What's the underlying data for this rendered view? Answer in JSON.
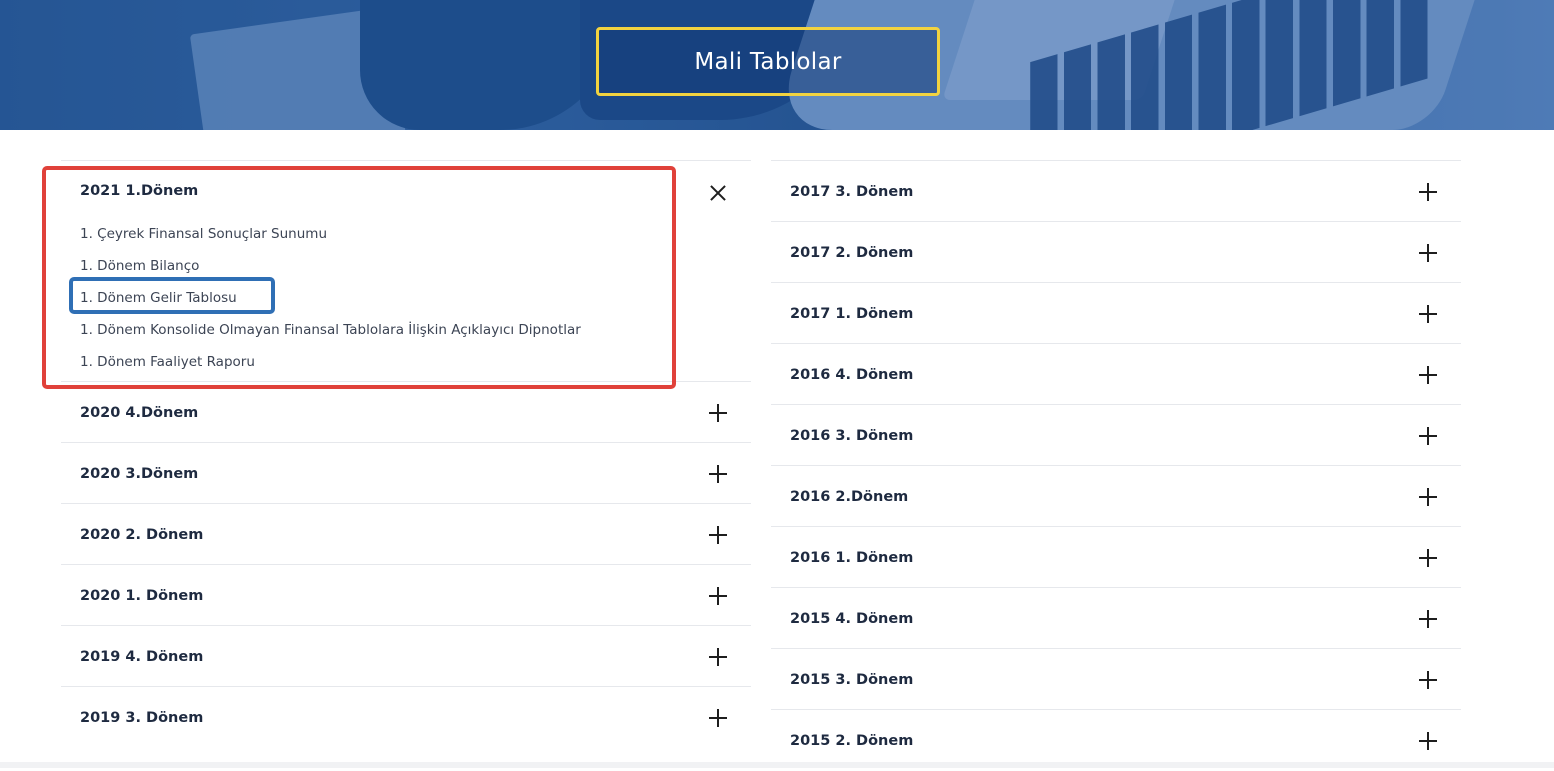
{
  "page": {
    "title": "Mali Tablolar"
  },
  "colors": {
    "title_border": "#f2d340",
    "highlight_red": "#e0413a",
    "highlight_blue": "#2f6fb5",
    "hero_blue": "#2f5f98"
  },
  "left_column": {
    "open_item": {
      "title": "2021 1.Dönem",
      "icon": "close-icon",
      "links": [
        "1. Çeyrek Finansal Sonuçlar Sunumu",
        "1. Dönem Bilanço",
        "1. Dönem Gelir Tablosu",
        "1. Dönem Konsolide Olmayan Finansal Tablolara İlişkin Açıklayıcı Dipnotlar",
        "1. Dönem Faaliyet Raporu"
      ]
    },
    "items": [
      "2020 4.Dönem",
      "2020 3.Dönem",
      "2020 2. Dönem",
      "2020 1. Dönem",
      "2019 4. Dönem",
      "2019 3. Dönem"
    ]
  },
  "right_column": {
    "items": [
      "2017 3. Dönem",
      "2017 2. Dönem",
      "2017 1. Dönem",
      "2016 4. Dönem",
      "2016 3. Dönem",
      "2016 2.Dönem",
      "2016 1. Dönem",
      "2015 4. Dönem",
      "2015 3. Dönem",
      "2015 2. Dönem"
    ]
  }
}
